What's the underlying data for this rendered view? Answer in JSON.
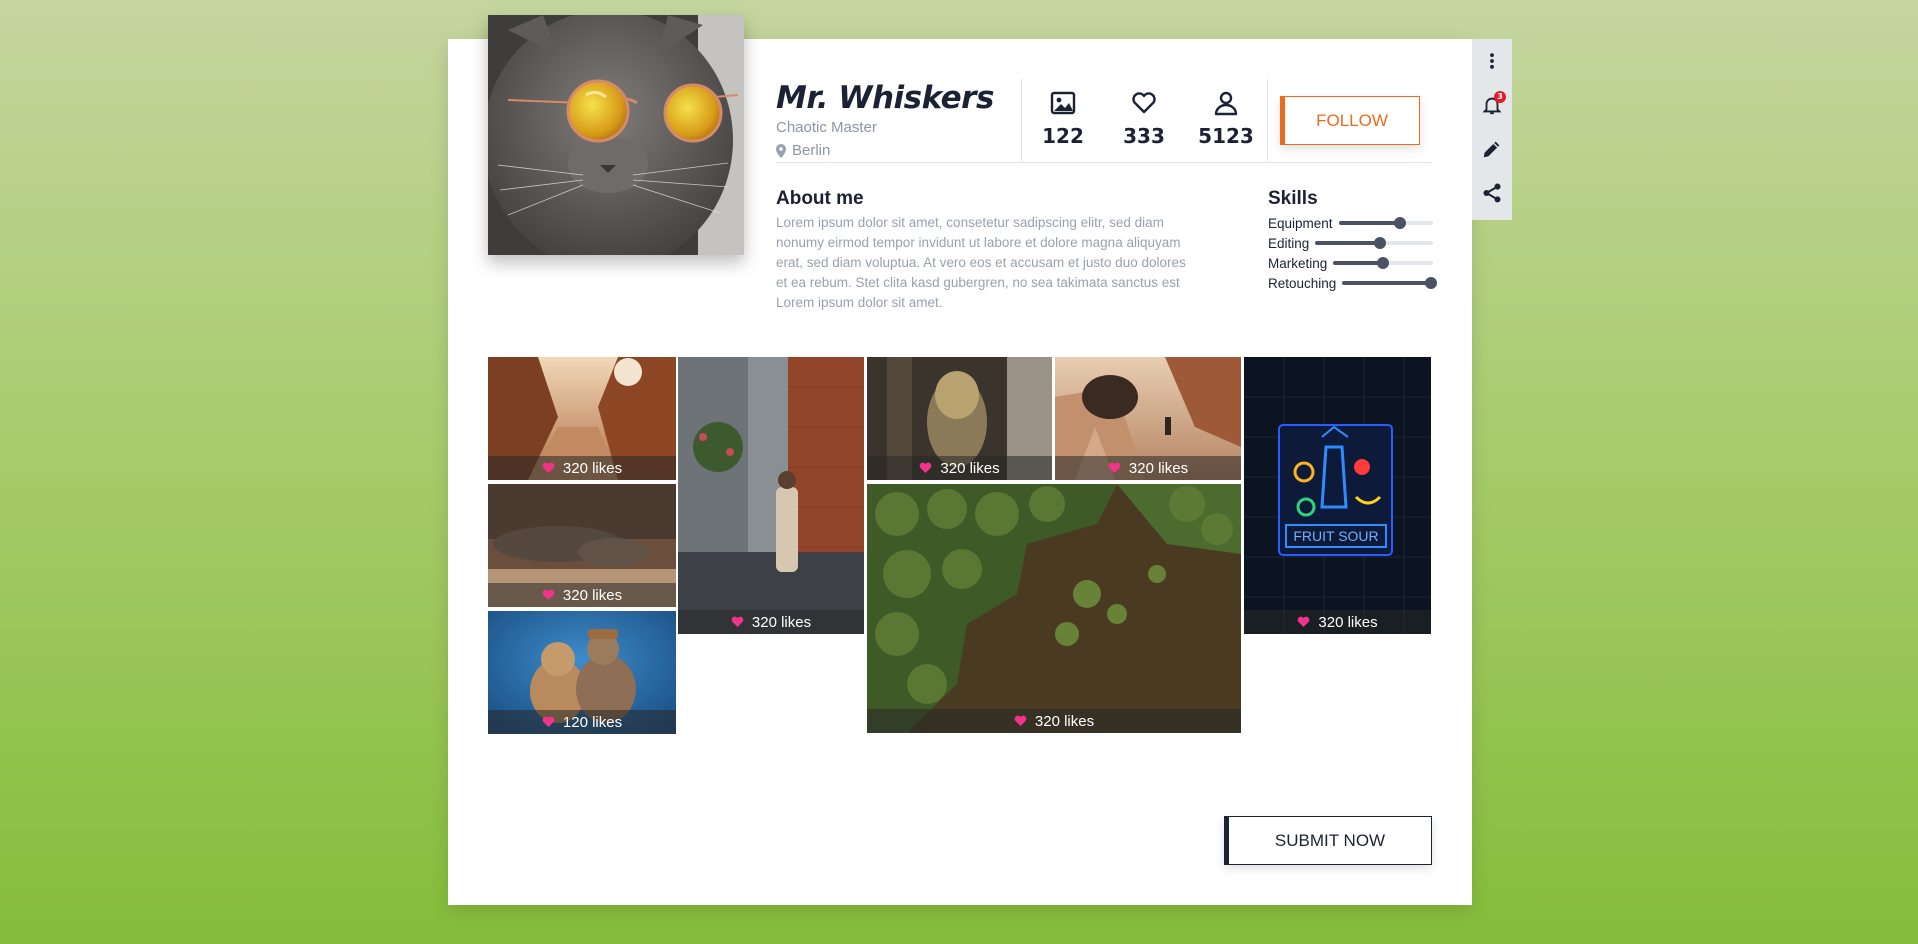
{
  "colors": {
    "accent_orange": "#ee6a1f",
    "dark_text": "#1b2233",
    "muted_text": "#9aa1ad",
    "heart_pink": "#f0348a",
    "badge_red": "#e21b2c"
  },
  "profile": {
    "name": "Mr. Whiskers",
    "title": "Chaotic Master",
    "location": "Berlin",
    "avatar_icon": "cat-with-sunglasses"
  },
  "stats": [
    {
      "icon": "image-icon",
      "value": "122"
    },
    {
      "icon": "heart-icon",
      "value": "333"
    },
    {
      "icon": "user-icon",
      "value": "5123"
    }
  ],
  "follow_label": "FOLLOW",
  "about": {
    "heading": "About me",
    "text": "Lorem ipsum dolor sit amet, consetetur sadipscing elitr, sed diam nonumy eirmod tempor invidunt ut labore et dolore magna aliquyam erat, sed diam voluptua. At vero eos et accusam et justo duo dolores et ea rebum. Stet clita kasd gubergren, no sea takimata sanctus est Lorem ipsum dolor sit amet."
  },
  "skills": {
    "heading": "Skills",
    "items": [
      {
        "label": "Equipment",
        "level": 0.65
      },
      {
        "label": "Editing",
        "level": 0.55
      },
      {
        "label": "Marketing",
        "level": 0.5
      },
      {
        "label": "Retouching",
        "level": 0.98
      }
    ]
  },
  "gallery": [
    {
      "likes": "320 likes",
      "subject": "canyon"
    },
    {
      "likes": "320 likes",
      "subject": "lizard"
    },
    {
      "likes": "120 likes",
      "subject": "dogs"
    },
    {
      "likes": "320 likes",
      "subject": "alley-woman"
    },
    {
      "likes": "320 likes",
      "subject": "statue"
    },
    {
      "likes": "320 likes",
      "subject": "desert-walk"
    },
    {
      "likes": "320 likes",
      "subject": "aerial-palms"
    },
    {
      "likes": "320 likes",
      "subject": "neon-fruit-sour",
      "sign_text": "FRUIT SOUR"
    }
  ],
  "submit_label": "SUBMIT NOW",
  "toolbar": {
    "items": [
      "more-vertical-icon",
      "bell-icon",
      "pencil-icon",
      "share-icon"
    ],
    "notification_count": "3"
  }
}
